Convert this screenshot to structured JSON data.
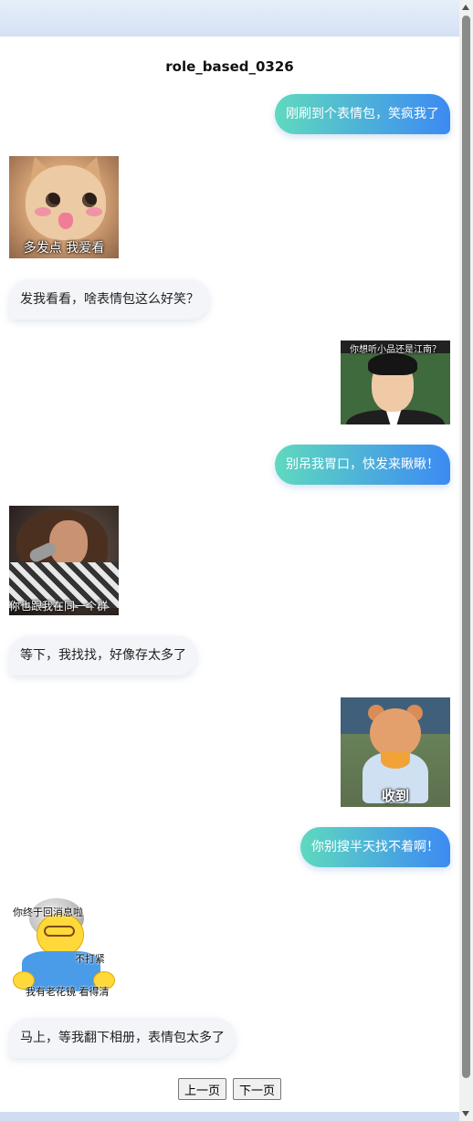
{
  "title": "role_based_0326",
  "messages": [
    {
      "role": "self",
      "kind": "text",
      "text": "刚刷到个表情包，笑疯我了"
    },
    {
      "role": "other",
      "kind": "sticker",
      "sticker": "cat-sticker",
      "caption": "多发点 我爱看"
    },
    {
      "role": "other",
      "kind": "text",
      "text": "发我看看，啥表情包这么好笑？"
    },
    {
      "role": "self",
      "kind": "sticker",
      "sticker": "man-sticker",
      "caption": "你想听小品还是江南？"
    },
    {
      "role": "self",
      "kind": "text",
      "text": "别吊我胃口，快发来瞅瞅！"
    },
    {
      "role": "other",
      "kind": "sticker",
      "sticker": "singer-sticker",
      "caption": "你也跟我在同一个群"
    },
    {
      "role": "other",
      "kind": "text",
      "text": "等下，我找找，好像存太多了"
    },
    {
      "role": "self",
      "kind": "sticker",
      "sticker": "bear-sticker",
      "caption": "收到"
    },
    {
      "role": "self",
      "kind": "text",
      "text": "你别搜半天找不着啊！"
    },
    {
      "role": "other",
      "kind": "sticker",
      "sticker": "cartoon-sticker",
      "captions": [
        "你终于回消息啦",
        "不打紧",
        "我有老花镜 看得清"
      ]
    },
    {
      "role": "other",
      "kind": "text",
      "text": "马上，等我翻下相册，表情包太多了"
    }
  ],
  "pager": {
    "prev_label": "上一页",
    "next_label": "下一页"
  },
  "colors": {
    "outgoing_gradient_start": "#5fd9be",
    "outgoing_gradient_end": "#3c8af3",
    "incoming_bg": "#f3f5f9"
  }
}
